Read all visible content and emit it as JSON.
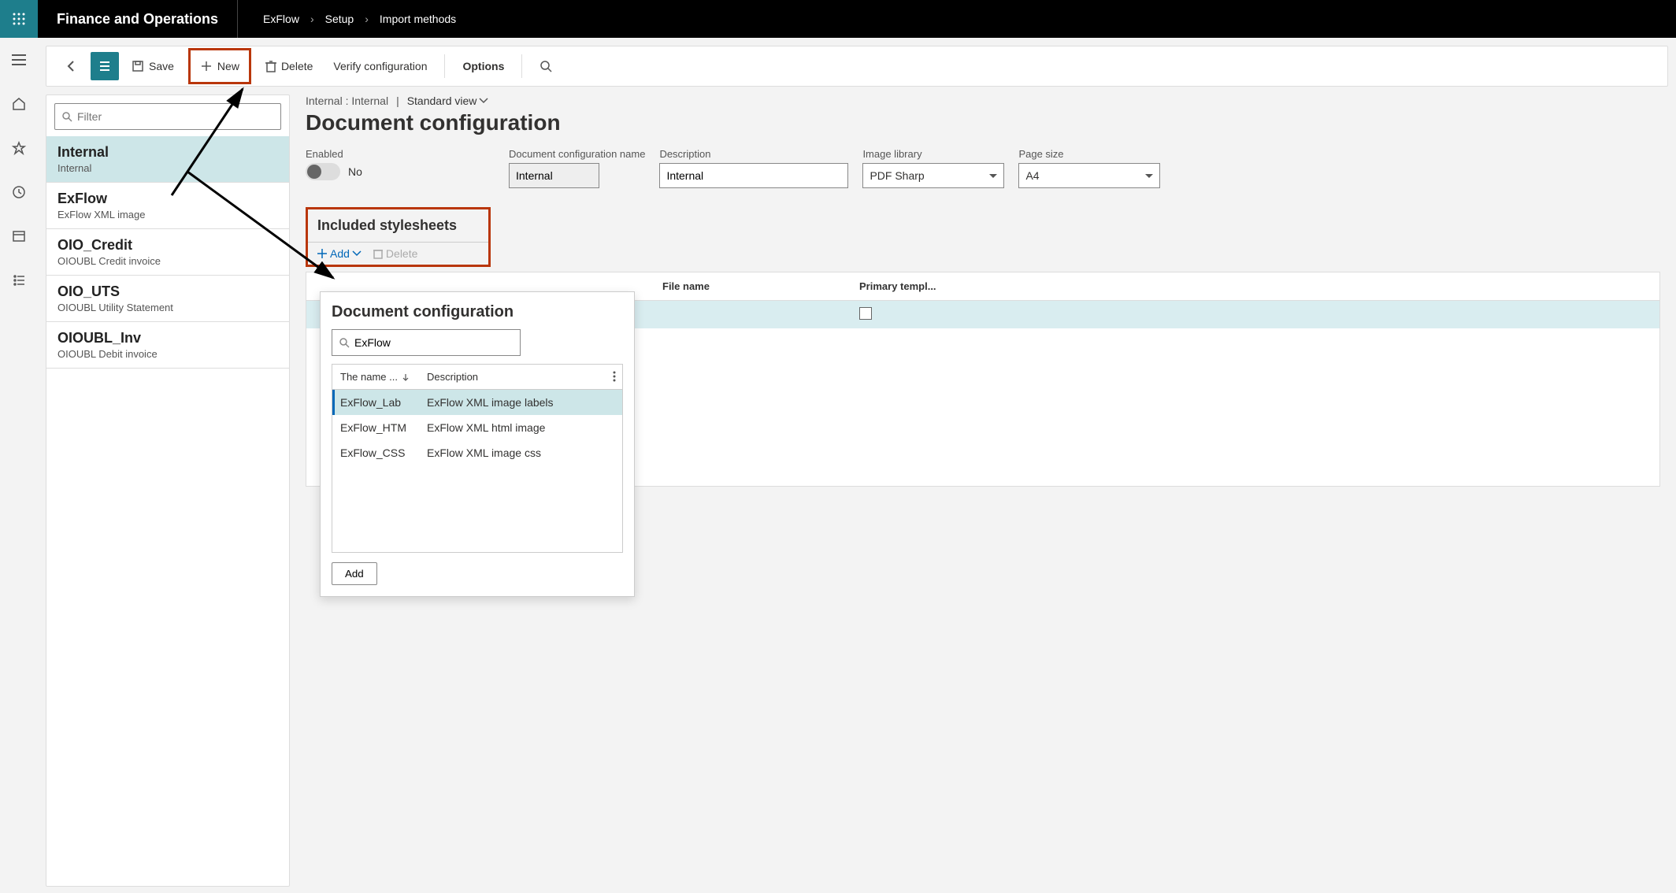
{
  "app_name": "Finance and Operations",
  "breadcrumb": [
    "ExFlow",
    "Setup",
    "Import methods"
  ],
  "actions": {
    "save": "Save",
    "new": "New",
    "delete": "Delete",
    "verify": "Verify configuration",
    "options": "Options"
  },
  "filter_placeholder": "Filter",
  "list": [
    {
      "title": "Internal",
      "sub": "Internal",
      "selected": true
    },
    {
      "title": "ExFlow",
      "sub": "ExFlow XML image"
    },
    {
      "title": "OIO_Credit",
      "sub": "OIOUBL Credit invoice"
    },
    {
      "title": "OIO_UTS",
      "sub": "OIOUBL Utility Statement"
    },
    {
      "title": "OIOUBL_Inv",
      "sub": "OIOUBL Debit invoice"
    }
  ],
  "detail": {
    "breadcrumb": "Internal : Internal",
    "view_label": "Standard view",
    "title": "Document configuration",
    "enabled_label": "Enabled",
    "enabled_value": "No",
    "name_label": "Document configuration name",
    "name_value": "Internal",
    "desc_label": "Description",
    "desc_value": "Internal",
    "imglib_label": "Image library",
    "imglib_value": "PDF Sharp",
    "pagesize_label": "Page size",
    "pagesize_value": "A4"
  },
  "stylesheets": {
    "section_title": "Included stylesheets",
    "add": "Add",
    "delete": "Delete",
    "grid_headers": {
      "file": "File name",
      "primary": "Primary templ..."
    }
  },
  "flyout": {
    "title": "Document configuration",
    "search_value": "ExFlow",
    "col_name": "The name ...",
    "col_desc": "Description",
    "rows": [
      {
        "name": "ExFlow_Lab",
        "desc": "ExFlow XML image labels",
        "selected": true
      },
      {
        "name": "ExFlow_HTM",
        "desc": "ExFlow XML html image"
      },
      {
        "name": "ExFlow_CSS",
        "desc": "ExFlow XML image css"
      }
    ],
    "add_btn": "Add"
  }
}
